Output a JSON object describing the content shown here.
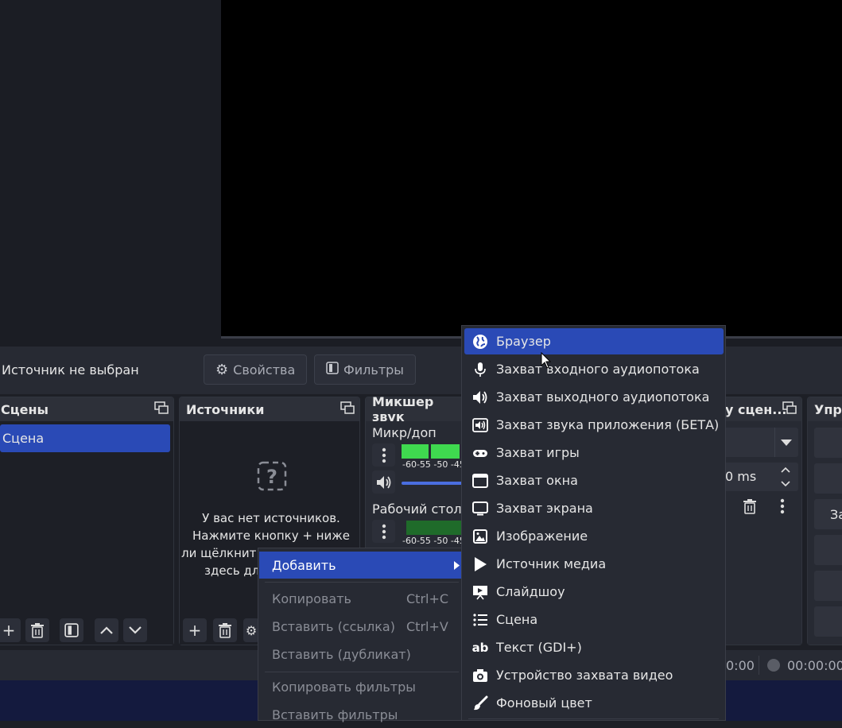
{
  "preview": {},
  "toolbar": {
    "source_status": "Источник не выбран",
    "properties_label": "Свойства",
    "filters_label": "Фильтры"
  },
  "scenes": {
    "title": "Сцены",
    "items": [
      "Сцена"
    ]
  },
  "sources": {
    "title": "Источники",
    "empty_line1": "У вас нет источников.",
    "empty_line2": "Нажмите кнопку + ниже",
    "empty_line3": "ли щёлкнит",
    "empty_line4": "здесь для"
  },
  "mixer": {
    "title": "Микшер звук",
    "channels": [
      {
        "name": "Микр/доп",
        "ticks": "-60-55 -50 -45"
      },
      {
        "name": "Рабочий стол",
        "ticks": "-60-55 -50 -45"
      }
    ]
  },
  "transitions": {
    "title": "у сцен...",
    "duration": "0 ms"
  },
  "controls": {
    "title": "Упра",
    "partial_button": "За"
  },
  "status": {
    "time1": "0:00",
    "time2": "00:00:00"
  },
  "context_menu": {
    "items": [
      {
        "label": "Добавить",
        "shortcut": ""
      },
      {
        "label": "Копировать",
        "shortcut": "Ctrl+C"
      },
      {
        "label": "Вставить (ссылка)",
        "shortcut": "Ctrl+V"
      },
      {
        "label": "Вставить (дубликат)",
        "shortcut": ""
      },
      {
        "label": "Копировать фильтры",
        "shortcut": ""
      },
      {
        "label": "Вставить фильтры",
        "shortcut": ""
      }
    ]
  },
  "submenu": {
    "items": [
      {
        "label": "Браузер",
        "icon": "globe-icon"
      },
      {
        "label": "Захват входного аудиопотока",
        "icon": "microphone-icon"
      },
      {
        "label": "Захват выходного аудиопотока",
        "icon": "speaker-icon"
      },
      {
        "label": "Захват звука приложения (БЕТА)",
        "icon": "app-audio-icon"
      },
      {
        "label": "Захват игры",
        "icon": "gamepad-icon"
      },
      {
        "label": "Захват окна",
        "icon": "window-icon"
      },
      {
        "label": "Захват экрана",
        "icon": "monitor-icon"
      },
      {
        "label": "Изображение",
        "icon": "image-icon"
      },
      {
        "label": "Источник медиа",
        "icon": "play-icon"
      },
      {
        "label": "Слайдшоу",
        "icon": "slideshow-icon"
      },
      {
        "label": "Сцена",
        "icon": "list-icon"
      },
      {
        "label": "Текст (GDI+)",
        "icon": "text-icon"
      },
      {
        "label": "Устройство захвата видео",
        "icon": "camera-icon"
      },
      {
        "label": "Фоновый цвет",
        "icon": "brush-icon"
      }
    ]
  },
  "colors": {
    "accent": "#2a4ab6",
    "meter_green": "#3fd94f"
  }
}
